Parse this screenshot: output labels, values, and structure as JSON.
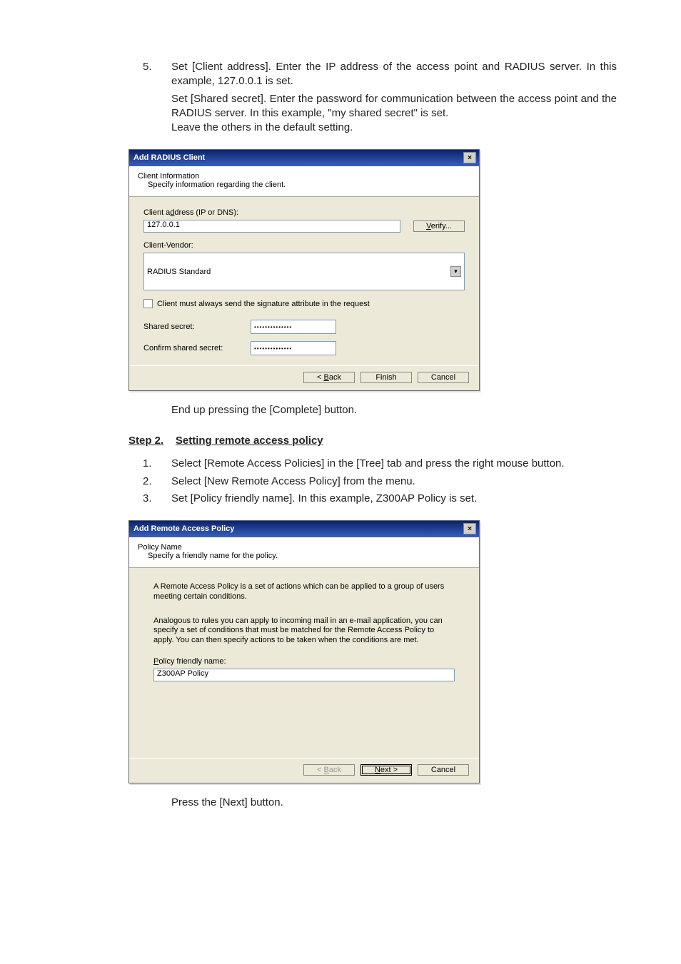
{
  "body": {
    "step5_num": "5.",
    "step5_l1": "Set [Client address]. Enter the IP address of the access point and RADIUS server. In this example, 127.0.0.1 is set.",
    "step5_l2": "Set [Shared secret]. Enter the password for communication between the access point and the RADIUS server. In this example, \"my shared secret\" is set.",
    "step5_l3": "Leave the others in the default setting.",
    "after_d1": "End up pressing the [Complete] button.",
    "step2_header_a": "Step 2.",
    "step2_header_b": "Setting remote access policy",
    "s2_n1": "1.",
    "s2_t1": "Select [Remote Access Policies] in the [Tree] tab and press the right mouse button.",
    "s2_n2": "2.",
    "s2_t2": "Select [New Remote Access Policy] from the menu.",
    "s2_n3": "3.",
    "s2_t3": "Set [Policy friendly name].   In this example, Z300AP Policy is set.",
    "after_d2": "Press the [Next] button."
  },
  "dialog1": {
    "title": "Add RADIUS Client",
    "sub_heading": "Client Information",
    "sub_desc": "Specify information regarding the client.",
    "addr_label_pre": "Client a",
    "addr_label_ul": "d",
    "addr_label_post": "dress (IP or DNS):",
    "addr_value": "127.0.0.1",
    "verify_pre": "",
    "verify_ul": "V",
    "verify_post": "erify...",
    "vendor_label": "Client-Vendor:",
    "vendor_value": "RADIUS Standard",
    "sig_ul": "C",
    "sig_post": "lient must always send the signature attribute in the request",
    "shared_ul": "S",
    "shared_post": "hared secret:",
    "confirm_pre": "Co",
    "confirm_ul": "n",
    "confirm_post": "firm shared secret:",
    "secret_value": "••••••••••••••",
    "btn_back_ul": "B",
    "btn_back_pre": "< ",
    "btn_back_post": "ack",
    "btn_finish": "Finish",
    "btn_cancel": "Cancel"
  },
  "dialog2": {
    "title": "Add Remote Access Policy",
    "sub_heading": "Policy Name",
    "sub_desc": "Specify a friendly name for the policy.",
    "intro1": "A Remote Access Policy is a set of actions which can be applied to a group of users meeting certain conditions.",
    "intro2": "Analogous to rules you can apply to incoming mail in an e-mail application, you can specify a set of conditions that must be matched for the Remote Access Policy to apply. You can then specify actions to be taken when the conditions are met.",
    "name_label_ul": "P",
    "name_label_post": "olicy friendly name:",
    "name_value": "Z300AP Policy",
    "btn_back_ul": "B",
    "btn_back_pre": "< ",
    "btn_back_post": "ack",
    "btn_next_ul": "N",
    "btn_next_post": "ext >",
    "btn_cancel": "Cancel"
  }
}
